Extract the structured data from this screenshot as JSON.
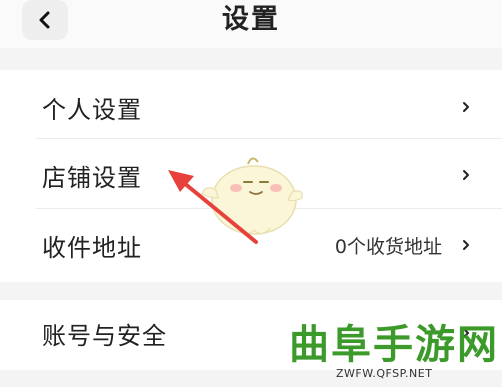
{
  "header": {
    "title": "设置",
    "back_icon": "chevron-left-icon"
  },
  "settings": {
    "group1": [
      {
        "label": "个人设置",
        "value": "",
        "icon": "chevron-right-icon"
      },
      {
        "label": "店铺设置",
        "value": "",
        "icon": "chevron-right-icon"
      },
      {
        "label": "收件地址",
        "value": "0个收货地址",
        "icon": "chevron-right-icon"
      }
    ],
    "group2": [
      {
        "label": "账号与安全",
        "value": "",
        "icon": "chevron-right-icon"
      }
    ]
  },
  "annotation": {
    "arrow_color": "#e8403a"
  },
  "watermark": {
    "brand": "曲阜手游网",
    "url": "ZWFW.QFSP.NET",
    "color": "#3b9a2a"
  }
}
